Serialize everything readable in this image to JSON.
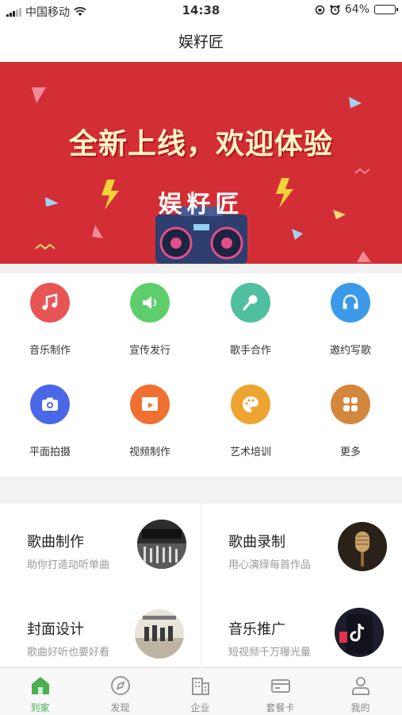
{
  "status_bar": {
    "carrier": "中国移动",
    "time": "14:38",
    "battery": "64%",
    "battery_level": 0.64
  },
  "nav": {
    "title": "娱籽匠"
  },
  "banner": {
    "headline": "全新上线，欢迎体验",
    "logo": "娱籽匠"
  },
  "services": [
    {
      "label": "音乐制作",
      "icon": "music-note-icon",
      "color": "#e85555"
    },
    {
      "label": "宣传发行",
      "icon": "speaker-icon",
      "color": "#5dce6b"
    },
    {
      "label": "歌手合作",
      "icon": "microphone-icon",
      "color": "#4fbf9f"
    },
    {
      "label": "邀约写歌",
      "icon": "headphones-icon",
      "color": "#3b9ae8"
    },
    {
      "label": "平面拍摄",
      "icon": "camera-icon",
      "color": "#4a67e6"
    },
    {
      "label": "视频制作",
      "icon": "video-icon",
      "color": "#ef7030"
    },
    {
      "label": "艺术培训",
      "icon": "palette-icon",
      "color": "#eea431"
    },
    {
      "label": "更多",
      "icon": "more-grid-icon",
      "color": "#d2873d"
    }
  ],
  "cards": [
    {
      "title": "歌曲制作",
      "subtitle": "助你打造动听单曲",
      "image": "mixing-console-image"
    },
    {
      "title": "歌曲录制",
      "subtitle": "用心演绎每首作品",
      "image": "studio-microphone-image"
    },
    {
      "title": "封面设计",
      "subtitle": "歌曲好听也要好看",
      "image": "album-cover-image"
    },
    {
      "title": "音乐推广",
      "subtitle": "短视频千万曝光量",
      "image": "tiktok-phone-image"
    }
  ],
  "tabs": [
    {
      "label": "到家",
      "icon": "home-icon",
      "active": true
    },
    {
      "label": "发现",
      "icon": "compass-icon",
      "active": false
    },
    {
      "label": "企业",
      "icon": "building-icon",
      "active": false
    },
    {
      "label": "套餐卡",
      "icon": "card-icon",
      "active": false
    },
    {
      "label": "我的",
      "icon": "user-icon",
      "active": false
    }
  ],
  "colors": {
    "banner": "#d32e36",
    "active_tab": "#4caf50"
  }
}
